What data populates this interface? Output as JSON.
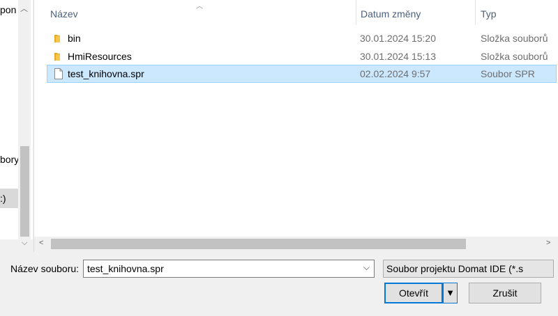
{
  "nav": {
    "items": [
      "pon V",
      "bory",
      ":)"
    ]
  },
  "columns": {
    "name": "Název",
    "date": "Datum změny",
    "type": "Typ"
  },
  "files": [
    {
      "name": "bin",
      "date": "30.01.2024 15:20",
      "type": "Složka souborů",
      "icon": "folder-icon",
      "selected": false
    },
    {
      "name": "HmiResources",
      "date": "30.01.2024 15:13",
      "type": "Složka souborů",
      "icon": "folder-icon",
      "selected": false
    },
    {
      "name": "test_knihovna.spr",
      "date": "02.02.2024 9:57",
      "type": "Soubor SPR",
      "icon": "file-icon",
      "selected": true
    }
  ],
  "footer": {
    "filename_label": "Název souboru:",
    "filename_value": "test_knihovna.spr",
    "filetype_value": "Soubor projektu Domat IDE (*.s",
    "open_label": "Otevřít",
    "cancel_label": "Zrušit"
  },
  "colors": {
    "selection": "#cce8ff",
    "accent": "#0078d7",
    "folder": "#f8c54b"
  }
}
